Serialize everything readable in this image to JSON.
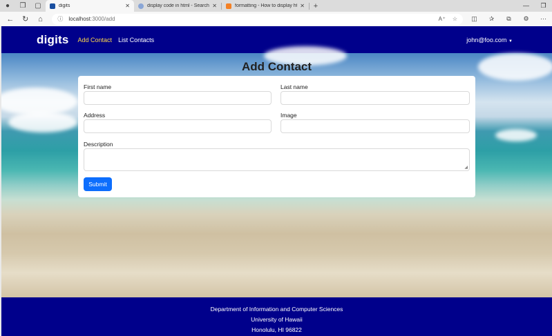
{
  "browser": {
    "tabs": [
      {
        "title": "digits",
        "active": true,
        "favicon_color": "#1a4fa0"
      },
      {
        "title": "display code in html - Search",
        "active": false,
        "favicon_color": "#8aa6d6"
      },
      {
        "title": "formatting - How to display html",
        "active": false,
        "favicon_color": "#f48024"
      }
    ],
    "url_host": "localhost",
    "url_path": ":3000/add"
  },
  "navbar": {
    "brand": "digits",
    "links": [
      "Add Contact",
      "List Contacts"
    ],
    "active_link": "Add Contact",
    "user": "john@foo.com"
  },
  "form": {
    "title": "Add Contact",
    "fields": {
      "first_name": {
        "label": "First name",
        "value": ""
      },
      "last_name": {
        "label": "Last name",
        "value": ""
      },
      "address": {
        "label": "Address",
        "value": ""
      },
      "image": {
        "label": "Image",
        "value": ""
      },
      "description": {
        "label": "Description",
        "value": ""
      }
    },
    "submit_label": "Submit"
  },
  "footer": {
    "lines": [
      "Department of Information and Computer Sciences",
      "University of Hawaii",
      "Honolulu, HI 96822"
    ]
  },
  "colors": {
    "navbar_bg": "#00008b",
    "active_link": "#ffd84a",
    "primary_button": "#0d6efd"
  }
}
